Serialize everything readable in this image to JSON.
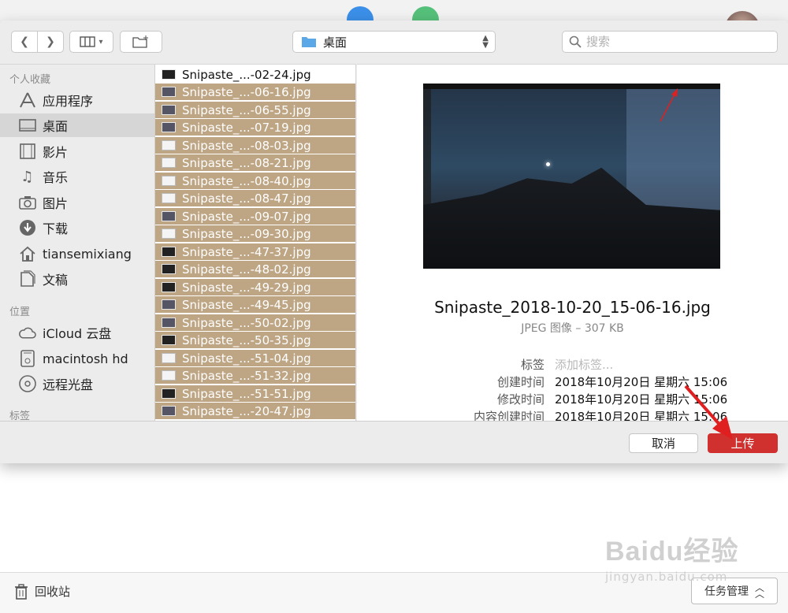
{
  "toolbar": {
    "location_label": "桌面",
    "search_placeholder": "搜索"
  },
  "sidebar": {
    "favorites_heading": "个人收藏",
    "favorites": [
      {
        "label": "应用程序",
        "icon": "applications-icon"
      },
      {
        "label": "桌面",
        "icon": "desktop-icon",
        "selected": true
      },
      {
        "label": "影片",
        "icon": "movies-icon"
      },
      {
        "label": "音乐",
        "icon": "music-icon"
      },
      {
        "label": "图片",
        "icon": "pictures-icon"
      },
      {
        "label": "下载",
        "icon": "downloads-icon"
      },
      {
        "label": "tiansemixiang",
        "icon": "home-icon"
      },
      {
        "label": "文稿",
        "icon": "documents-icon"
      }
    ],
    "locations_heading": "位置",
    "locations": [
      {
        "label": "iCloud 云盘",
        "icon": "icloud-icon"
      },
      {
        "label": "macintosh hd",
        "icon": "disk-icon"
      },
      {
        "label": "远程光盘",
        "icon": "optical-disc-icon"
      }
    ],
    "tags_heading": "标签"
  },
  "files": [
    {
      "name": "Snipaste_...-02-24.jpg",
      "selected": false
    },
    {
      "name": "Snipaste_...-06-16.jpg",
      "selected": true
    },
    {
      "name": "Snipaste_...-06-55.jpg",
      "selected": true
    },
    {
      "name": "Snipaste_...-07-19.jpg",
      "selected": true
    },
    {
      "name": "Snipaste_...-08-03.jpg",
      "selected": true
    },
    {
      "name": "Snipaste_...-08-21.jpg",
      "selected": true
    },
    {
      "name": "Snipaste_...-08-40.jpg",
      "selected": true
    },
    {
      "name": "Snipaste_...-08-47.jpg",
      "selected": true
    },
    {
      "name": "Snipaste_...-09-07.jpg",
      "selected": true
    },
    {
      "name": "Snipaste_...-09-30.jpg",
      "selected": true
    },
    {
      "name": "Snipaste_...-47-37.jpg",
      "selected": true
    },
    {
      "name": "Snipaste_...-48-02.jpg",
      "selected": true
    },
    {
      "name": "Snipaste_...-49-29.jpg",
      "selected": true
    },
    {
      "name": "Snipaste_...-49-45.jpg",
      "selected": true
    },
    {
      "name": "Snipaste_...-50-02.jpg",
      "selected": true
    },
    {
      "name": "Snipaste_...-50-35.jpg",
      "selected": true
    },
    {
      "name": "Snipaste_...-51-04.jpg",
      "selected": true
    },
    {
      "name": "Snipaste_...-51-32.jpg",
      "selected": true
    },
    {
      "name": "Snipaste_...-51-51.jpg",
      "selected": true
    },
    {
      "name": "Snipaste_...-20-47.jpg",
      "selected": true
    }
  ],
  "preview": {
    "filename": "Snipaste_2018-10-20_15-06-16.jpg",
    "meta": "JPEG 图像 – 307 KB",
    "tags_label": "标签",
    "tags_placeholder": "添加标签...",
    "created_label": "创建时间",
    "created_value": "2018年10月20日 星期六 15:06",
    "modified_label": "修改时间",
    "modified_value": "2018年10月20日 星期六 15:06",
    "content_created_label": "内容创建时间",
    "content_created_value": "2018年10月20日 星期六 15:06"
  },
  "footer": {
    "cancel_label": "取消",
    "upload_label": "上传"
  },
  "bottom_bar": {
    "trash_label": "回收站",
    "task_manager_label": "任务管理"
  },
  "watermark": {
    "main": "Baidu经验",
    "sub": "jingyan.baidu.com"
  },
  "colors": {
    "selection": "#bea584",
    "upload_button": "#d0302e",
    "annotation_arrow": "#e02020"
  }
}
